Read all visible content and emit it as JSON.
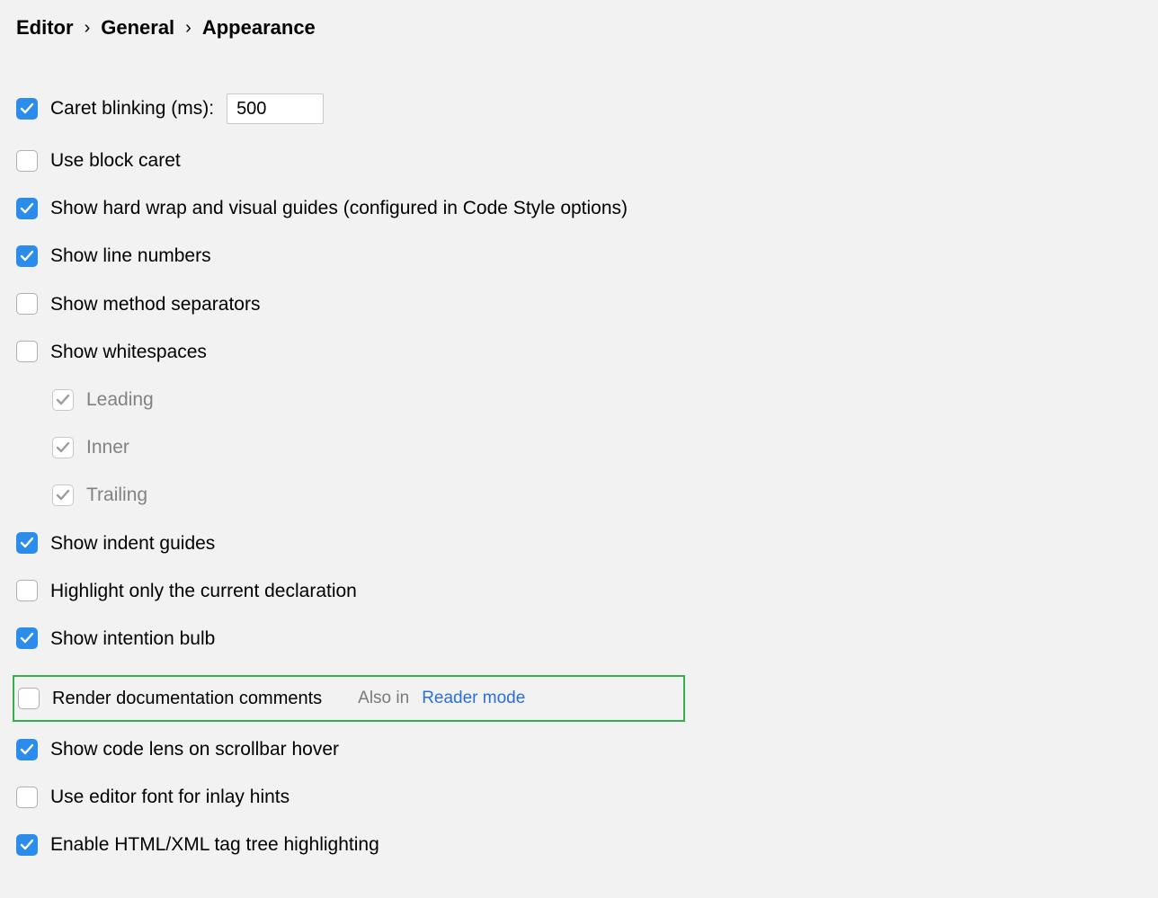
{
  "breadcrumb": {
    "items": [
      "Editor",
      "General",
      "Appearance"
    ]
  },
  "options": {
    "caret_blinking": {
      "label": "Caret blinking (ms):",
      "checked": true,
      "value": "500"
    },
    "use_block_caret": {
      "label": "Use block caret",
      "checked": false
    },
    "show_hard_wrap": {
      "label": "Show hard wrap and visual guides (configured in Code Style options)",
      "checked": true
    },
    "show_line_numbers": {
      "label": "Show line numbers",
      "checked": true
    },
    "show_method_separators": {
      "label": "Show method separators",
      "checked": false
    },
    "show_whitespaces": {
      "label": "Show whitespaces",
      "checked": false
    },
    "ws_leading": {
      "label": "Leading",
      "checked": true
    },
    "ws_inner": {
      "label": "Inner",
      "checked": true
    },
    "ws_trailing": {
      "label": "Trailing",
      "checked": true
    },
    "show_indent_guides": {
      "label": "Show indent guides",
      "checked": true
    },
    "highlight_declaration": {
      "label": "Highlight only the current declaration",
      "checked": false
    },
    "show_intention_bulb": {
      "label": "Show intention bulb",
      "checked": true
    },
    "render_doc_comments": {
      "label": "Render documentation comments",
      "checked": false
    },
    "also_in_text": "Also in",
    "reader_mode_link": "Reader mode",
    "show_code_lens": {
      "label": "Show code lens on scrollbar hover",
      "checked": true
    },
    "use_editor_font_inlay": {
      "label": "Use editor font for inlay hints",
      "checked": false
    },
    "enable_html_xml_tag": {
      "label": "Enable HTML/XML tag tree highlighting",
      "checked": true
    }
  }
}
